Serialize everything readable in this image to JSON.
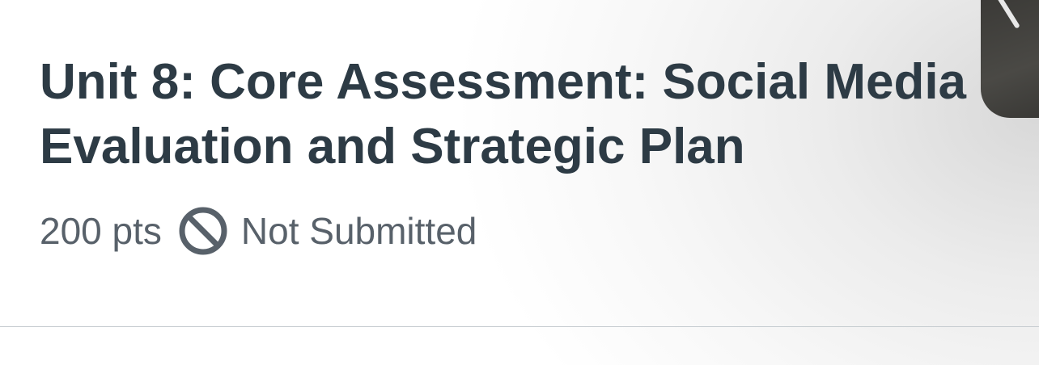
{
  "assignment": {
    "title": "Unit 8: Core Assessment: Social Media Evaluation and Strategic Plan",
    "points": "200 pts",
    "status": "Not Submitted",
    "status_icon": "not-submitted-icon"
  },
  "colors": {
    "title": "#2d3b45",
    "meta": "#58616a",
    "divider": "#c7cdd1"
  }
}
